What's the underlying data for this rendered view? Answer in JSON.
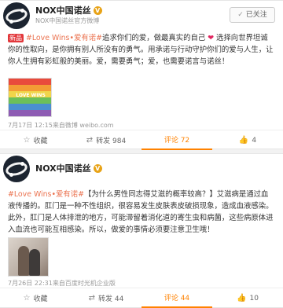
{
  "post1": {
    "account_name": "NOX中国诺丝",
    "verified": "V",
    "subtitle": "NOX中国诺丝官方微博",
    "follow_label": "已关注",
    "badge": "新品",
    "text_topic": "#Love Wins•爱有诺#",
    "text_main": "追求你们的爱，做最真实的自己",
    "text_heart": "❤",
    "text_rest": "选择向世界坦诚你的性取向，是你拥有别人所没有的勇气。用承诺与行动守护你们的爱与人生，让你人生拥有彩虹般的美丽。爱，需要勇气；爱，也需要诺言与诺丝！",
    "image_text": "LOVE WINS",
    "time_source": "7月17日 12:15来自微博 weibo.com",
    "actions": {
      "fav": "收藏",
      "repost": "转发 984",
      "comment": "评论 72",
      "like": "4"
    }
  },
  "post2": {
    "account_name": "NOX中国诺丝",
    "verified": "V",
    "text_topic": "#Love Wins•爱有诺#",
    "text_main": "【为什么男性同志得艾滋的概率较高？】艾滋病是通过血液传播的。肛门是一种不性组织，很容易发生皮肤表皮破损现象，造成血液感染。此外，肛门是人体排泄的地方，可能滞留着消化道的寄生虫和病菌，这些病原体进入血流也可能互相感染。所以，做爱的事情必须要注意卫生哦！",
    "time_source": "7月26日 22:31来自百度时光机企业版",
    "actions": {
      "fav": "收藏",
      "repost": "转发 44",
      "comment": "评论 44",
      "like": "10"
    }
  },
  "colors": {
    "accent": "#ff8200",
    "badge_red": "#e2373b",
    "verified": "#e8a317"
  }
}
